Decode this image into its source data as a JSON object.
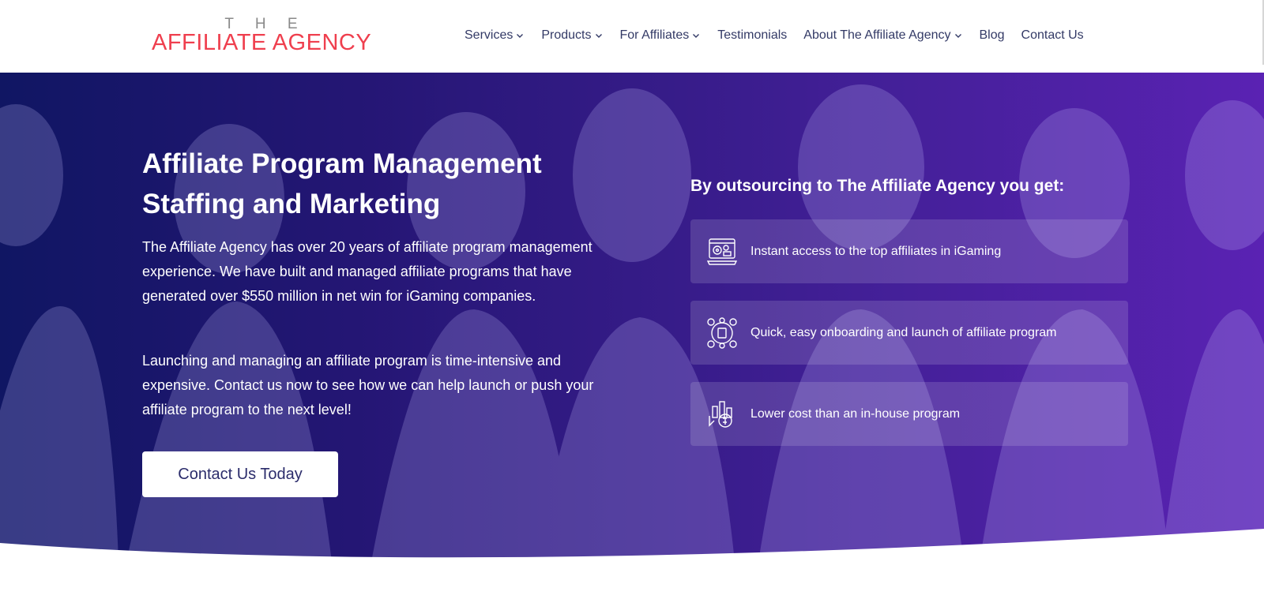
{
  "logo": {
    "top": "T H E",
    "main": "AFFILIATE AGENCY"
  },
  "nav": {
    "items": [
      {
        "label": "Services",
        "has_dropdown": true
      },
      {
        "label": "Products",
        "has_dropdown": true
      },
      {
        "label": "For Affiliates",
        "has_dropdown": true
      },
      {
        "label": "Testimonials",
        "has_dropdown": false
      },
      {
        "label": "About The Affiliate Agency",
        "has_dropdown": true
      },
      {
        "label": "Blog",
        "has_dropdown": false
      },
      {
        "label": "Contact Us",
        "has_dropdown": false
      }
    ]
  },
  "hero": {
    "title": "Affiliate Program Management Staffing and Marketing",
    "paragraph_1": "The Affiliate Agency has over 20 years of affiliate program management experience. We have built and managed affiliate programs that have generated over $550 million in net win for iGaming companies.",
    "paragraph_2": "Launching and managing an affiliate program is time-intensive and expensive.  Contact us now to see how we can help launch or push your affiliate program to the next level!",
    "cta_label": "Contact Us Today"
  },
  "benefits": {
    "title": "By outsourcing to The Affiliate Agency you get:",
    "items": [
      {
        "icon": "gaming-laptop-icon",
        "text": "Instant access to the top affiliates in iGaming"
      },
      {
        "icon": "network-onboarding-icon",
        "text": "Quick, easy onboarding and launch of affiliate program"
      },
      {
        "icon": "cost-down-icon",
        "text": "Lower cost than an in-house program"
      }
    ]
  },
  "colors": {
    "brand_red": "#ef3f4e",
    "nav_text": "#333a66",
    "hero_gradient_start": "#101663",
    "hero_gradient_end": "#5a22b3",
    "cta_text": "#2b2c6b"
  }
}
